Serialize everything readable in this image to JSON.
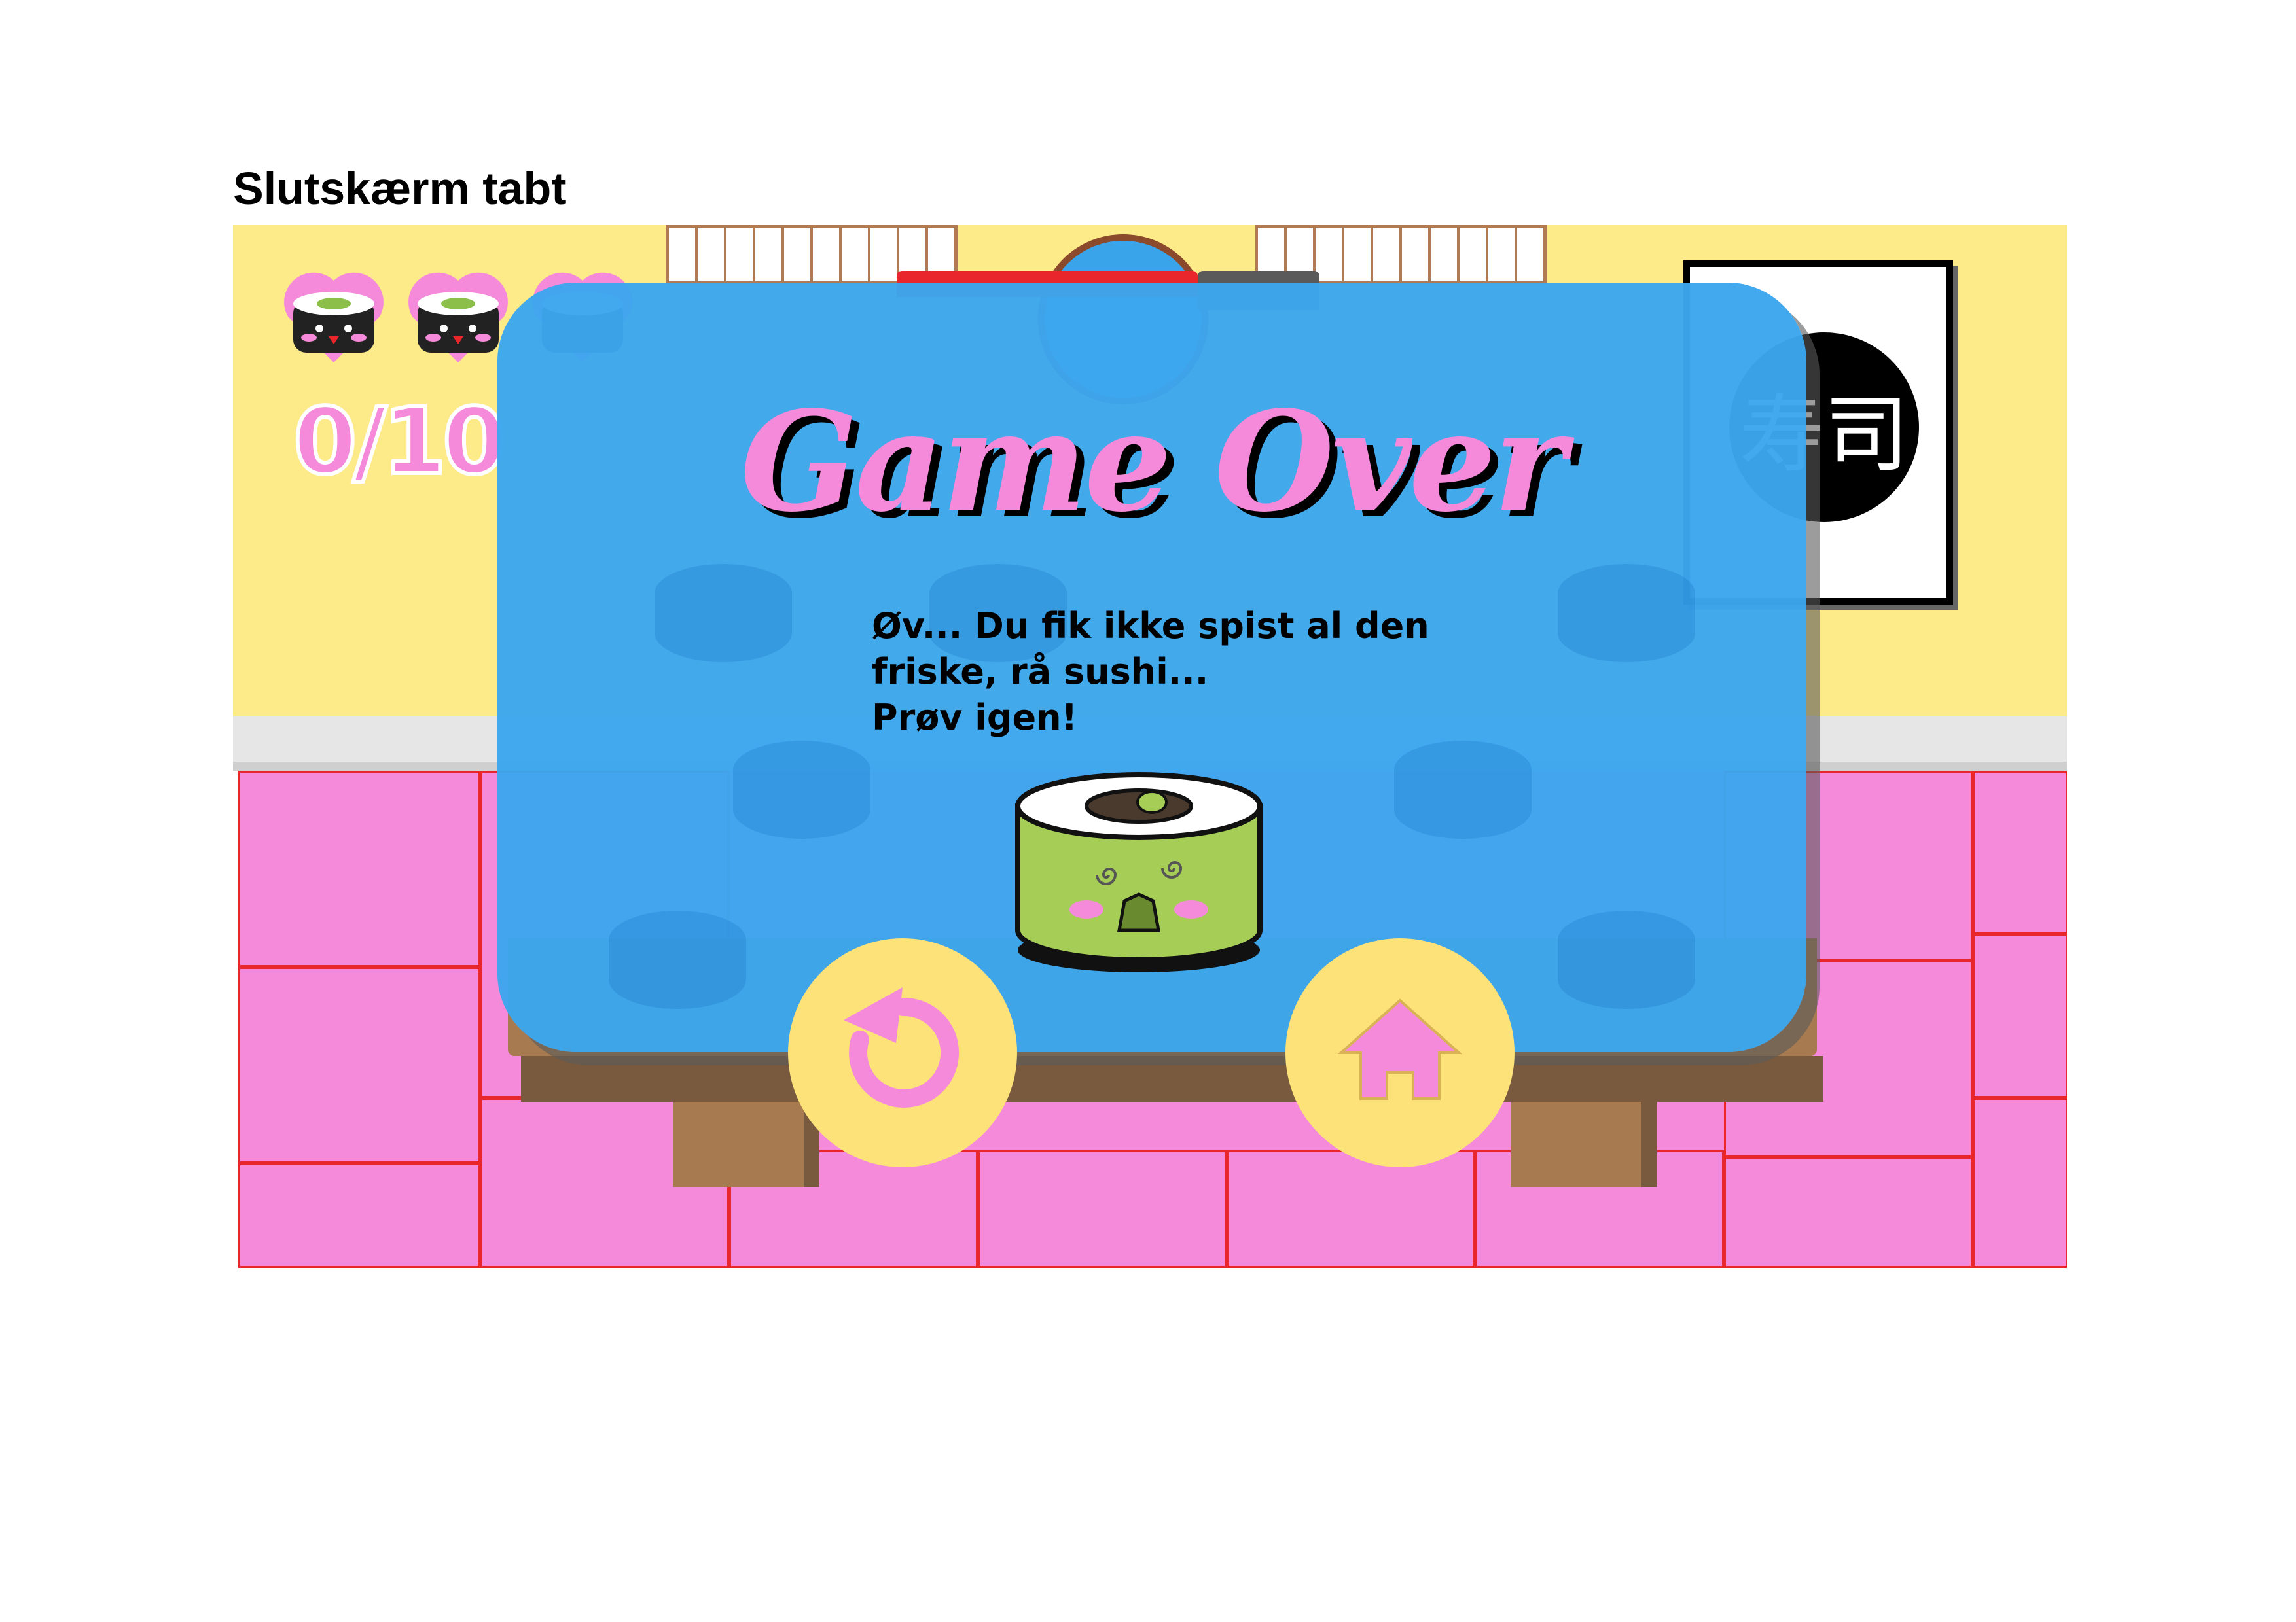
{
  "page": {
    "heading": "Slutskærm tabt"
  },
  "hud": {
    "score_text": "0/10",
    "lives": [
      {
        "name": "life-1",
        "state": "active"
      },
      {
        "name": "life-2",
        "state": "active"
      },
      {
        "name": "life-3",
        "state": "active"
      }
    ]
  },
  "poster": {
    "kanji": "寿司"
  },
  "dialog": {
    "title": "Game Over",
    "message_lines": [
      "Øv... Du fik ikke spist al den",
      "friske, rå sushi...",
      "Prøv igen!"
    ]
  },
  "buttons": {
    "retry": {
      "icon": "retry-icon"
    },
    "home": {
      "icon": "home-icon"
    }
  },
  "colors": {
    "wall": "#fdea88",
    "floor": "#f48ad9",
    "tile_line": "#e8262b",
    "dialog": "#3ca6ee",
    "title_pink": "#f48ad9",
    "button_yellow": "#fde27a",
    "sushi_green": "#a6ce57"
  }
}
